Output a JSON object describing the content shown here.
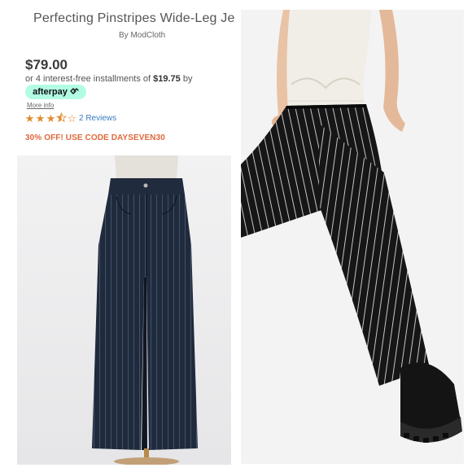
{
  "product": {
    "title": "Perfecting Pinstripes Wide-Leg Je",
    "brand": "By ModCloth",
    "price": "$79.00",
    "installments_prefix": "or 4 interest-free installments of ",
    "installment_amount": "$19.75",
    "installments_suffix": " by",
    "afterpay_label": "afterpay",
    "afterpay_icon": "afterpay-loop-icon",
    "more_info": "More info",
    "rating": 3.5,
    "rating_max": 5,
    "reviews": "2 Reviews",
    "promo": "30% OFF! USE CODE DAYSEVEN30"
  },
  "colors": {
    "accent_orange": "#e0683a",
    "star_color": "#e08a2e",
    "link_blue": "#3b7bbf",
    "afterpay_mint": "#b2fce4",
    "denim": "#1f2a3c",
    "pants_black": "#161616"
  },
  "images": {
    "left_photo": "wide-leg pinstripe jeans on mannequin",
    "right_photo": "model wearing black pinstripe wide-leg pants"
  }
}
